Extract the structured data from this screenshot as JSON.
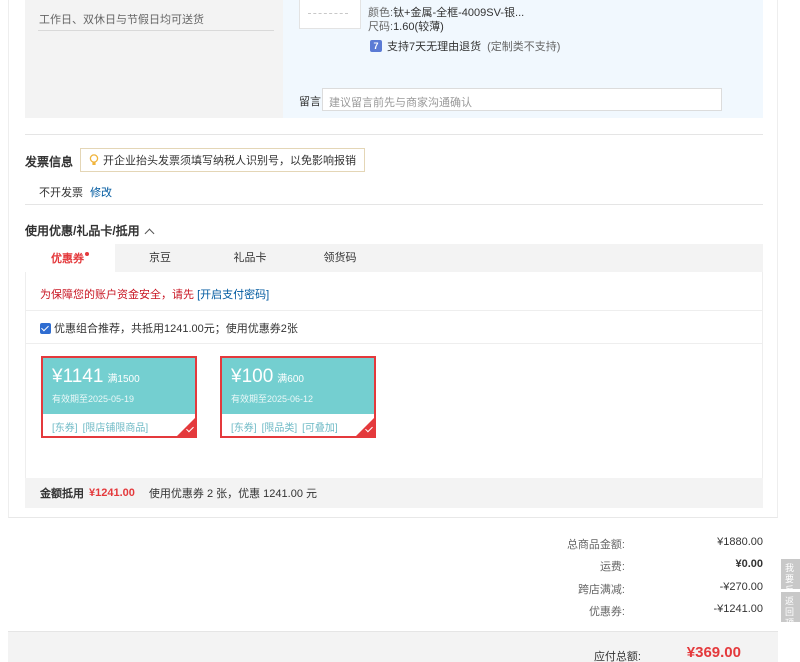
{
  "shipping": {
    "note": "工作日、双休日与节假日均可送货"
  },
  "item": {
    "color_label": "颜色:",
    "color_value": "钛+金属-全框-4009SV-银...",
    "size_label": "尺码:",
    "size_value": "1.60(较薄)",
    "return_icon": "7",
    "return_policy": "支持7天无理由退货",
    "return_note": "(定制类不支持)",
    "message_label": "留言:",
    "message_placeholder": "建议留言前先与商家沟通确认"
  },
  "invoice": {
    "title": "发票信息",
    "tip": "开企业抬头发票须填写纳税人识别号，以免影响报销",
    "value": "不开发票",
    "edit_label": "修改"
  },
  "discounts": {
    "title": "使用优惠/礼品卡/抵用",
    "tabs": [
      {
        "label": "优惠券",
        "active": true
      },
      {
        "label": "京豆",
        "active": false
      },
      {
        "label": "礼品卡",
        "active": false
      },
      {
        "label": "领货码",
        "active": false
      }
    ],
    "security_warning": "为保障您的账户资金安全，请先",
    "security_link": "[开启支付密码]",
    "combo_label": "优惠组合推荐，共抵用1241.00元；使用优惠券2张",
    "coupons": [
      {
        "amount": "¥1141",
        "condition": "满1500",
        "expiry": "有效期至2025-05-19",
        "tags": [
          "[东券]",
          "[限店铺限商品]"
        ]
      },
      {
        "amount": "¥100",
        "condition": "满600",
        "expiry": "有效期至2025-06-12",
        "tags": [
          "[东券]",
          "[限品类]",
          "[可叠加]"
        ]
      }
    ],
    "summary_label": "金额抵用",
    "summary_amount": "¥1241.00",
    "summary_detail": "使用优惠券 2 张，优惠 1241.00 元"
  },
  "totals": {
    "rows": [
      {
        "label": "总商品金额:",
        "value": "¥1880.00"
      },
      {
        "label": "运费:",
        "value": "¥0.00"
      },
      {
        "label": "跨店满减:",
        "value": "-¥270.00"
      },
      {
        "label": "优惠券:",
        "value": "-¥1241.00"
      }
    ],
    "payable_label": "应付总额:",
    "payable_amount": "¥369.00"
  },
  "side": {
    "feedback": "我要反馈",
    "back_top": "返回顶部"
  },
  "colors": {
    "accent_red": "#e4393c",
    "coupon_teal": "#74cfd0",
    "link_blue": "#005aa0"
  }
}
